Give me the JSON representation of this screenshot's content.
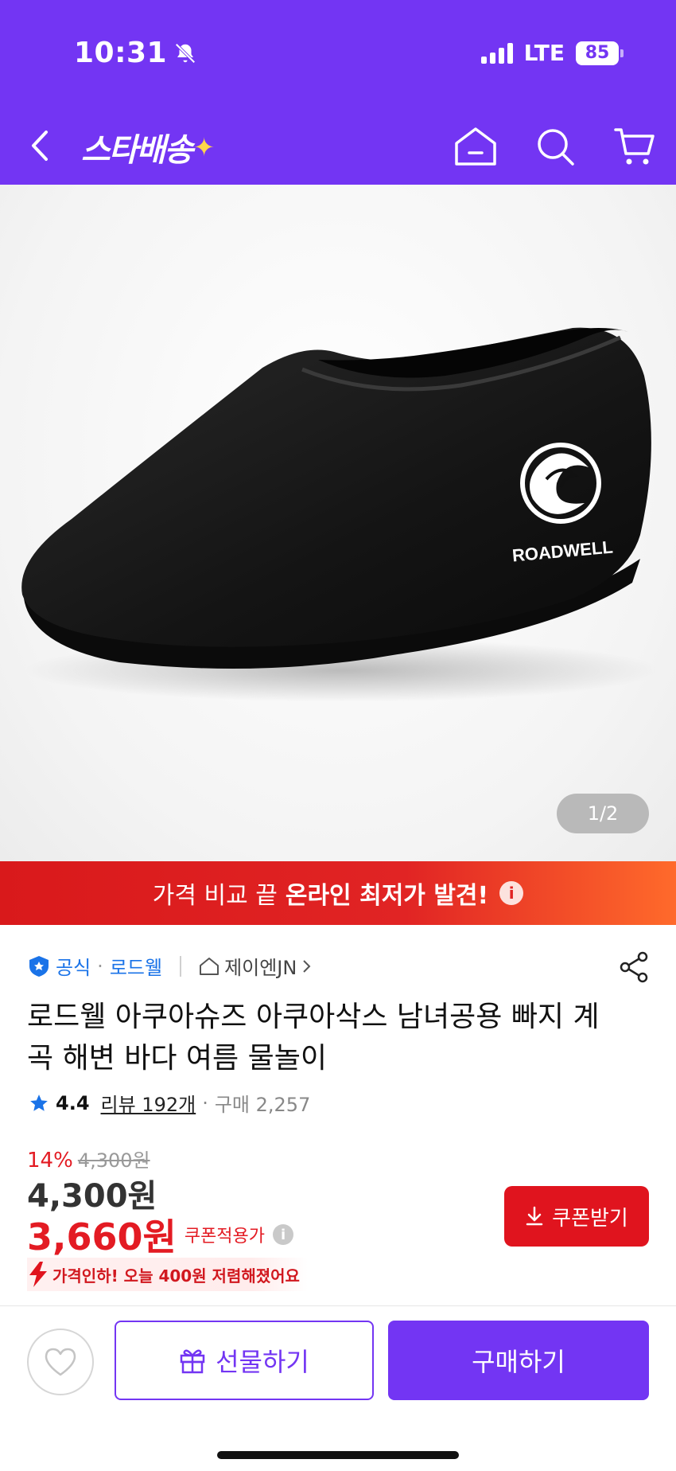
{
  "status": {
    "time": "10:31",
    "network": "LTE",
    "battery": "85"
  },
  "nav": {
    "logo": "스타배송",
    "logo_star": "✦"
  },
  "image": {
    "counter": "1/2",
    "brand_mark": "ROADWELL"
  },
  "banner": {
    "prefix": "가격 비교 끝",
    "highlight": "온라인 최저가 발견!",
    "info": "i"
  },
  "product": {
    "official": "공식",
    "brand": "로드웰",
    "store": "제이엔JN",
    "title": "로드웰 아쿠아슈즈 아쿠아삭스 남녀공용 빠지 계곡 해변 바다 여름 물놀이",
    "rating": "4.4",
    "reviews": "리뷰 192개",
    "purchases": "구매 2,257",
    "discount_pct": "14%",
    "original_price": "4,300원",
    "price": "4,300원",
    "coupon_price": "3,660원",
    "coupon_label": "쿠폰적용가",
    "price_drop": "가격인하! 오늘 400원 저렴해졌어요"
  },
  "actions": {
    "coupon": "쿠폰받기",
    "gift": "선물하기",
    "buy": "구매하기"
  },
  "colors": {
    "brand": "#7335f3",
    "sale": "#e31b23",
    "link": "#1a73e8"
  }
}
